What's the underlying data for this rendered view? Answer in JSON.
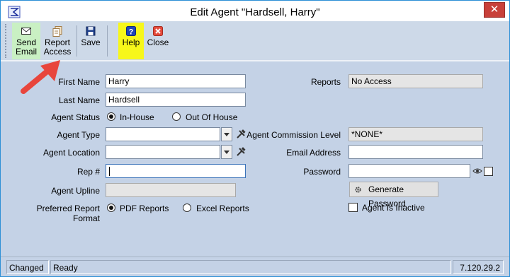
{
  "window": {
    "title": "Edit Agent \"Hardsell, Harry\"",
    "close_glyph": "✕"
  },
  "toolbar": {
    "send_email_line1": "Send",
    "send_email_line2": "Email",
    "report_access_line1": "Report",
    "report_access_line2": "Access",
    "save_label": "Save",
    "help_label": "Help",
    "close_label": "Close",
    "icons": [
      "envelope-icon",
      "report-icon",
      "floppy-icon",
      "help-icon",
      "close-icon"
    ],
    "colors": {
      "send_email_bg": "#c9f0c3",
      "help_bg": "#f7f71a"
    }
  },
  "form": {
    "first_name_label": "First Name",
    "first_name_value": "Harry",
    "last_name_label": "Last Name",
    "last_name_value": "Hardsell",
    "agent_status_label": "Agent Status",
    "status_in_house": "In-House",
    "status_out_of_house": "Out Of House",
    "agent_type_label": "Agent Type",
    "agent_type_value": "",
    "agent_location_label": "Agent Location",
    "agent_location_value": "",
    "rep_label": "Rep #",
    "rep_value": "",
    "upline_label": "Agent Upline",
    "upline_value": "",
    "report_format_label": "Preferred Report Format",
    "format_pdf": "PDF Reports",
    "format_excel": "Excel Reports",
    "reports_label": "Reports",
    "reports_value": "No Access",
    "commission_label": "Agent Commission Level",
    "commission_value": "*NONE*",
    "email_label": "Email Address",
    "email_value": "",
    "password_label": "Password",
    "password_value": "",
    "generate_password_label": "Generate Password",
    "inactive_label": "Agent Is Inactive",
    "selected_status": "In-House",
    "selected_format": "PDF Reports"
  },
  "status": {
    "changed": "Changed",
    "state": "Ready",
    "version": "7.120.29.2"
  },
  "annotation": {
    "arrow_color": "#e8453c"
  }
}
